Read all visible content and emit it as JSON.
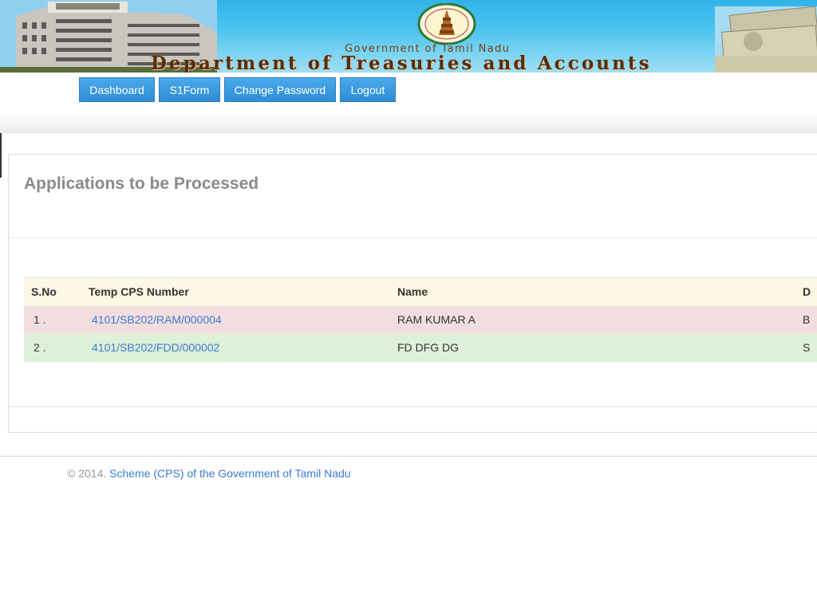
{
  "banner": {
    "gov_text": "Government of Tamil Nadu",
    "dept_text": "Department of Treasuries and Accounts",
    "colors": {
      "sky": "#2fb3ea",
      "title_brown": "#5a2c08"
    }
  },
  "nav": {
    "items": [
      {
        "label": "Dashboard"
      },
      {
        "label": "S1Form"
      },
      {
        "label": "Change Password"
      },
      {
        "label": "Logout"
      }
    ],
    "color": "#2e8ed6"
  },
  "panel": {
    "title": "Applications to be Processed"
  },
  "table": {
    "headers": [
      "S.No",
      "Temp CPS Number",
      "Name",
      "D"
    ],
    "rows": [
      {
        "sno": "1 .",
        "cps": "4101/SB202/RAM/000004",
        "name": "RAM KUMAR A",
        "extra": "B"
      },
      {
        "sno": "2 .",
        "cps": "4101/SB202/FDD/000002",
        "name": "FD DFG DG",
        "extra": "S"
      }
    ]
  },
  "footer": {
    "prefix": "© 2014.",
    "link": "Scheme (CPS) of the Government of Tamil Nadu"
  }
}
